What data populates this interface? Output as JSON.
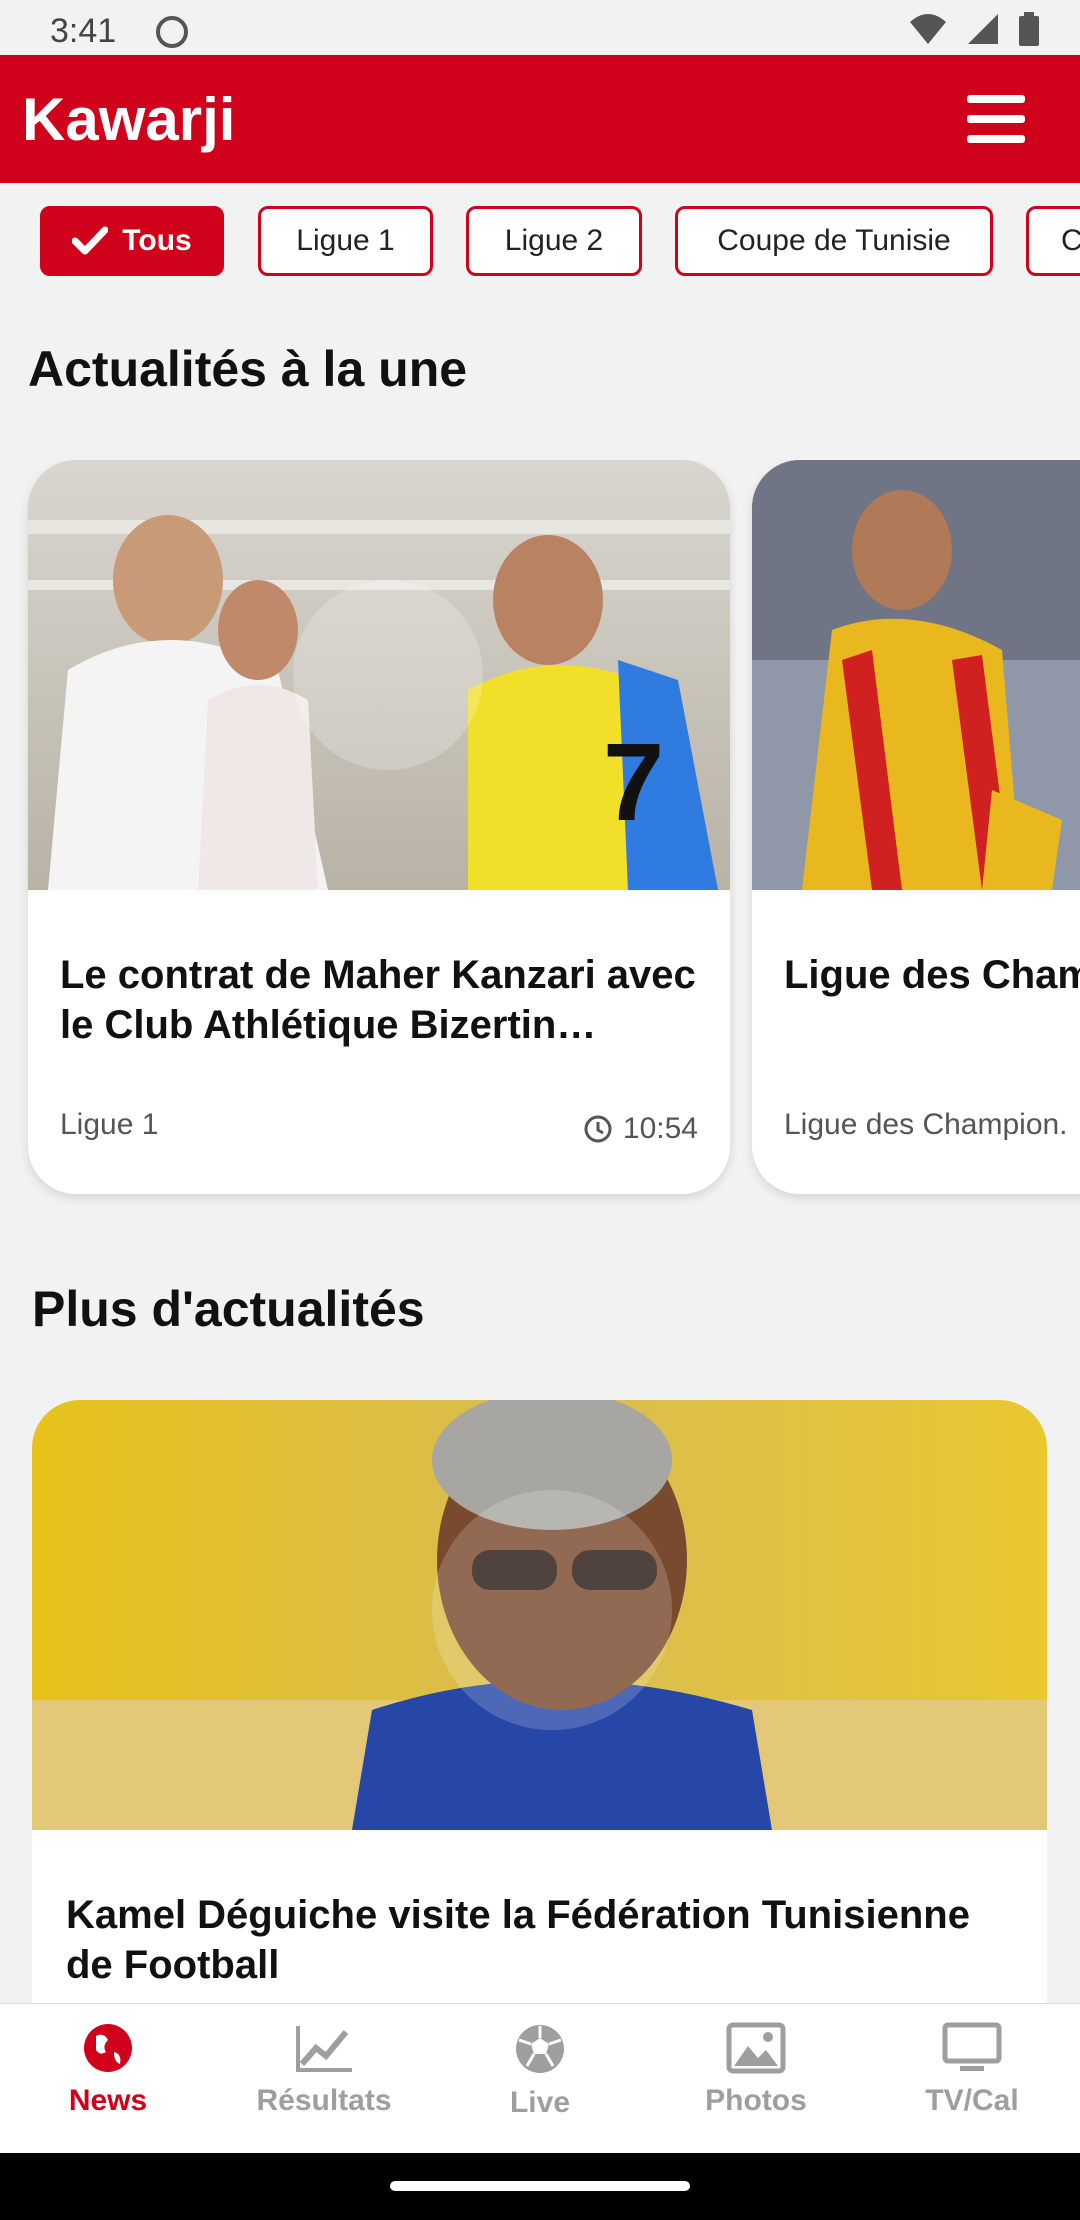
{
  "status_bar": {
    "time": "3:41"
  },
  "app_bar": {
    "title": "Kawarji"
  },
  "filters": [
    {
      "label": "Tous",
      "active": true
    },
    {
      "label": "Ligue 1",
      "active": false
    },
    {
      "label": "Ligue 2",
      "active": false
    },
    {
      "label": "Coupe de Tunisie",
      "active": false
    },
    {
      "label": "C",
      "active": false
    }
  ],
  "featured": {
    "section_title": "Actualités à la une",
    "cards": [
      {
        "title": "Le contrat de Maher Kanzari avec le Club Athlétique Bizertin…",
        "category": "Ligue 1",
        "time": "10:54"
      },
      {
        "title": "Ligue des Cham Programme des",
        "category": "Ligue des Champion."
      }
    ]
  },
  "more": {
    "section_title": "Plus d'actualités",
    "article": {
      "title": "Kamel Déguiche visite la Fédération Tunisienne de Football"
    }
  },
  "bottom_nav": [
    {
      "label": "News",
      "icon": "globe-icon",
      "active": true
    },
    {
      "label": "Résultats",
      "icon": "chart-icon",
      "active": false
    },
    {
      "label": "Live",
      "icon": "soccer-ball-icon",
      "active": false
    },
    {
      "label": "Photos",
      "icon": "image-icon",
      "active": false
    },
    {
      "label": "TV/Cal",
      "icon": "monitor-icon",
      "active": false
    }
  ],
  "colors": {
    "brand": "#d0021b",
    "inactive": "#9e9e9e"
  }
}
